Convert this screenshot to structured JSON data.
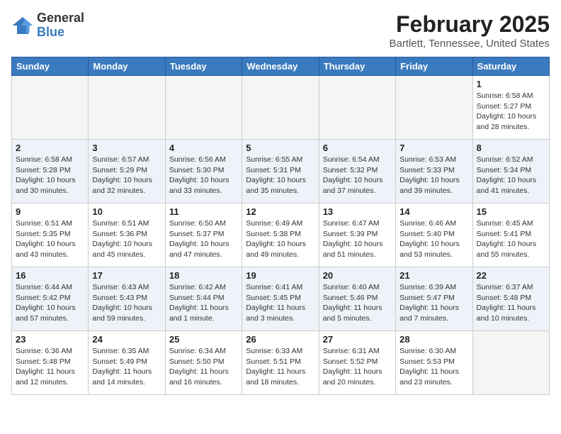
{
  "logo": {
    "general": "General",
    "blue": "Blue"
  },
  "title": {
    "month": "February 2025",
    "location": "Bartlett, Tennessee, United States"
  },
  "days_of_week": [
    "Sunday",
    "Monday",
    "Tuesday",
    "Wednesday",
    "Thursday",
    "Friday",
    "Saturday"
  ],
  "weeks": [
    {
      "days": [
        {
          "number": "",
          "info": ""
        },
        {
          "number": "",
          "info": ""
        },
        {
          "number": "",
          "info": ""
        },
        {
          "number": "",
          "info": ""
        },
        {
          "number": "",
          "info": ""
        },
        {
          "number": "",
          "info": ""
        },
        {
          "number": "1",
          "info": "Sunrise: 6:58 AM\nSunset: 5:27 PM\nDaylight: 10 hours and 28 minutes."
        }
      ]
    },
    {
      "days": [
        {
          "number": "2",
          "info": "Sunrise: 6:58 AM\nSunset: 5:28 PM\nDaylight: 10 hours and 30 minutes."
        },
        {
          "number": "3",
          "info": "Sunrise: 6:57 AM\nSunset: 5:29 PM\nDaylight: 10 hours and 32 minutes."
        },
        {
          "number": "4",
          "info": "Sunrise: 6:56 AM\nSunset: 5:30 PM\nDaylight: 10 hours and 33 minutes."
        },
        {
          "number": "5",
          "info": "Sunrise: 6:55 AM\nSunset: 5:31 PM\nDaylight: 10 hours and 35 minutes."
        },
        {
          "number": "6",
          "info": "Sunrise: 6:54 AM\nSunset: 5:32 PM\nDaylight: 10 hours and 37 minutes."
        },
        {
          "number": "7",
          "info": "Sunrise: 6:53 AM\nSunset: 5:33 PM\nDaylight: 10 hours and 39 minutes."
        },
        {
          "number": "8",
          "info": "Sunrise: 6:52 AM\nSunset: 5:34 PM\nDaylight: 10 hours and 41 minutes."
        }
      ]
    },
    {
      "days": [
        {
          "number": "9",
          "info": "Sunrise: 6:51 AM\nSunset: 5:35 PM\nDaylight: 10 hours and 43 minutes."
        },
        {
          "number": "10",
          "info": "Sunrise: 6:51 AM\nSunset: 5:36 PM\nDaylight: 10 hours and 45 minutes."
        },
        {
          "number": "11",
          "info": "Sunrise: 6:50 AM\nSunset: 5:37 PM\nDaylight: 10 hours and 47 minutes."
        },
        {
          "number": "12",
          "info": "Sunrise: 6:49 AM\nSunset: 5:38 PM\nDaylight: 10 hours and 49 minutes."
        },
        {
          "number": "13",
          "info": "Sunrise: 6:47 AM\nSunset: 5:39 PM\nDaylight: 10 hours and 51 minutes."
        },
        {
          "number": "14",
          "info": "Sunrise: 6:46 AM\nSunset: 5:40 PM\nDaylight: 10 hours and 53 minutes."
        },
        {
          "number": "15",
          "info": "Sunrise: 6:45 AM\nSunset: 5:41 PM\nDaylight: 10 hours and 55 minutes."
        }
      ]
    },
    {
      "days": [
        {
          "number": "16",
          "info": "Sunrise: 6:44 AM\nSunset: 5:42 PM\nDaylight: 10 hours and 57 minutes."
        },
        {
          "number": "17",
          "info": "Sunrise: 6:43 AM\nSunset: 5:43 PM\nDaylight: 10 hours and 59 minutes."
        },
        {
          "number": "18",
          "info": "Sunrise: 6:42 AM\nSunset: 5:44 PM\nDaylight: 11 hours and 1 minute."
        },
        {
          "number": "19",
          "info": "Sunrise: 6:41 AM\nSunset: 5:45 PM\nDaylight: 11 hours and 3 minutes."
        },
        {
          "number": "20",
          "info": "Sunrise: 6:40 AM\nSunset: 5:46 PM\nDaylight: 11 hours and 5 minutes."
        },
        {
          "number": "21",
          "info": "Sunrise: 6:39 AM\nSunset: 5:47 PM\nDaylight: 11 hours and 7 minutes."
        },
        {
          "number": "22",
          "info": "Sunrise: 6:37 AM\nSunset: 5:48 PM\nDaylight: 11 hours and 10 minutes."
        }
      ]
    },
    {
      "days": [
        {
          "number": "23",
          "info": "Sunrise: 6:36 AM\nSunset: 5:48 PM\nDaylight: 11 hours and 12 minutes."
        },
        {
          "number": "24",
          "info": "Sunrise: 6:35 AM\nSunset: 5:49 PM\nDaylight: 11 hours and 14 minutes."
        },
        {
          "number": "25",
          "info": "Sunrise: 6:34 AM\nSunset: 5:50 PM\nDaylight: 11 hours and 16 minutes."
        },
        {
          "number": "26",
          "info": "Sunrise: 6:33 AM\nSunset: 5:51 PM\nDaylight: 11 hours and 18 minutes."
        },
        {
          "number": "27",
          "info": "Sunrise: 6:31 AM\nSunset: 5:52 PM\nDaylight: 11 hours and 20 minutes."
        },
        {
          "number": "28",
          "info": "Sunrise: 6:30 AM\nSunset: 5:53 PM\nDaylight: 11 hours and 23 minutes."
        },
        {
          "number": "",
          "info": ""
        }
      ]
    }
  ]
}
